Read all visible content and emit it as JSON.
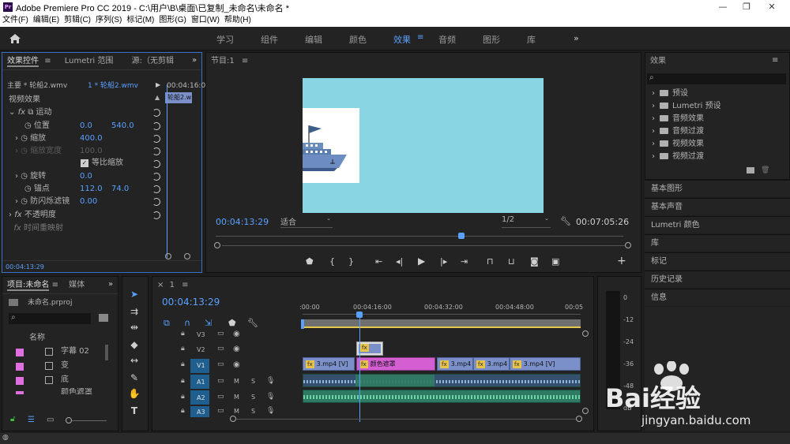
{
  "window": {
    "title": "Adobe Premiere Pro CC 2019 - C:\\用户\\B\\桌面\\已复制_未命名\\未命名 *",
    "logo": "Pr"
  },
  "menu": [
    "文件(F)",
    "编辑(E)",
    "剪辑(C)",
    "序列(S)",
    "标记(M)",
    "图形(G)",
    "窗口(W)",
    "帮助(H)"
  ],
  "workspaces": [
    "学习",
    "组件",
    "编辑",
    "颜色",
    "效果",
    "音频",
    "图形",
    "库"
  ],
  "workspace_active": "效果",
  "effect_controls": {
    "tabs": [
      "效果控件",
      "Lumetri 范围",
      "源:（无剪辑"
    ],
    "master": "主要 * 轮船2.wmv",
    "clip": "1 * 轮船2.wmv",
    "timecode_head": "00:04:16:0",
    "clip_bar": "轮船2.w",
    "section": "视频效果",
    "motion": "运动",
    "position_label": "位置",
    "position_x": "0.0",
    "position_y": "540.0",
    "scale_label": "缩放",
    "scale_value": "400.0",
    "scale_width_label": "缩放宽度",
    "scale_width_value": "100.0",
    "uniform_label": "等比缩放",
    "rotation_label": "旋转",
    "rotation_value": "0.0",
    "anchor_label": "锚点",
    "anchor_x": "112.0",
    "anchor_y": "74.0",
    "flicker_label": "防闪烁滤镜",
    "flicker_value": "0.00",
    "opacity": "不透明度",
    "time_remap": "时间重映射",
    "timecode": "00:04:13:29"
  },
  "program": {
    "title": "节目:1",
    "timecode": "00:04:13:29",
    "fit": "适合",
    "quality": "1/2",
    "duration": "00:07:05:26"
  },
  "effects_panel": {
    "title": "效果",
    "items": [
      "预设",
      "Lumetri 预设",
      "音频效果",
      "音频过渡",
      "视频效果",
      "视频过渡"
    ]
  },
  "side_panels": [
    "基本图形",
    "基本声音",
    "Lumetri 颜色",
    "库",
    "标记",
    "历史记录",
    "信息"
  ],
  "project": {
    "tabs": [
      "项目:未命名",
      "媒体"
    ],
    "file": "未命名.prproj",
    "col": "名称",
    "items": [
      "字幕 02",
      "变",
      "底",
      "颜色遮罩"
    ]
  },
  "timeline": {
    "tab": "1",
    "timecode": "00:04:13:29",
    "ruler": [
      ":00:00",
      "00:04:16:00",
      "00:04:32:00",
      "00:04:48:00",
      "00:05"
    ],
    "tracks": [
      "V3",
      "V2",
      "V1",
      "A1",
      "A2",
      "A3"
    ],
    "clips": {
      "v2": "fx",
      "v1a": "3.mp4 [V]",
      "v1b": "颜色遮罩",
      "v1c": "3.mp4",
      "v1d": "3.mp4",
      "v1e": "3.mp4 [V]"
    },
    "m": "M",
    "s": "S"
  },
  "meter": {
    "labels": [
      "0",
      "-12",
      "-24",
      "-36",
      "-48",
      "dB"
    ]
  },
  "watermark": {
    "brand": "Bai经验",
    "url": "jingyan.baidu.com"
  }
}
